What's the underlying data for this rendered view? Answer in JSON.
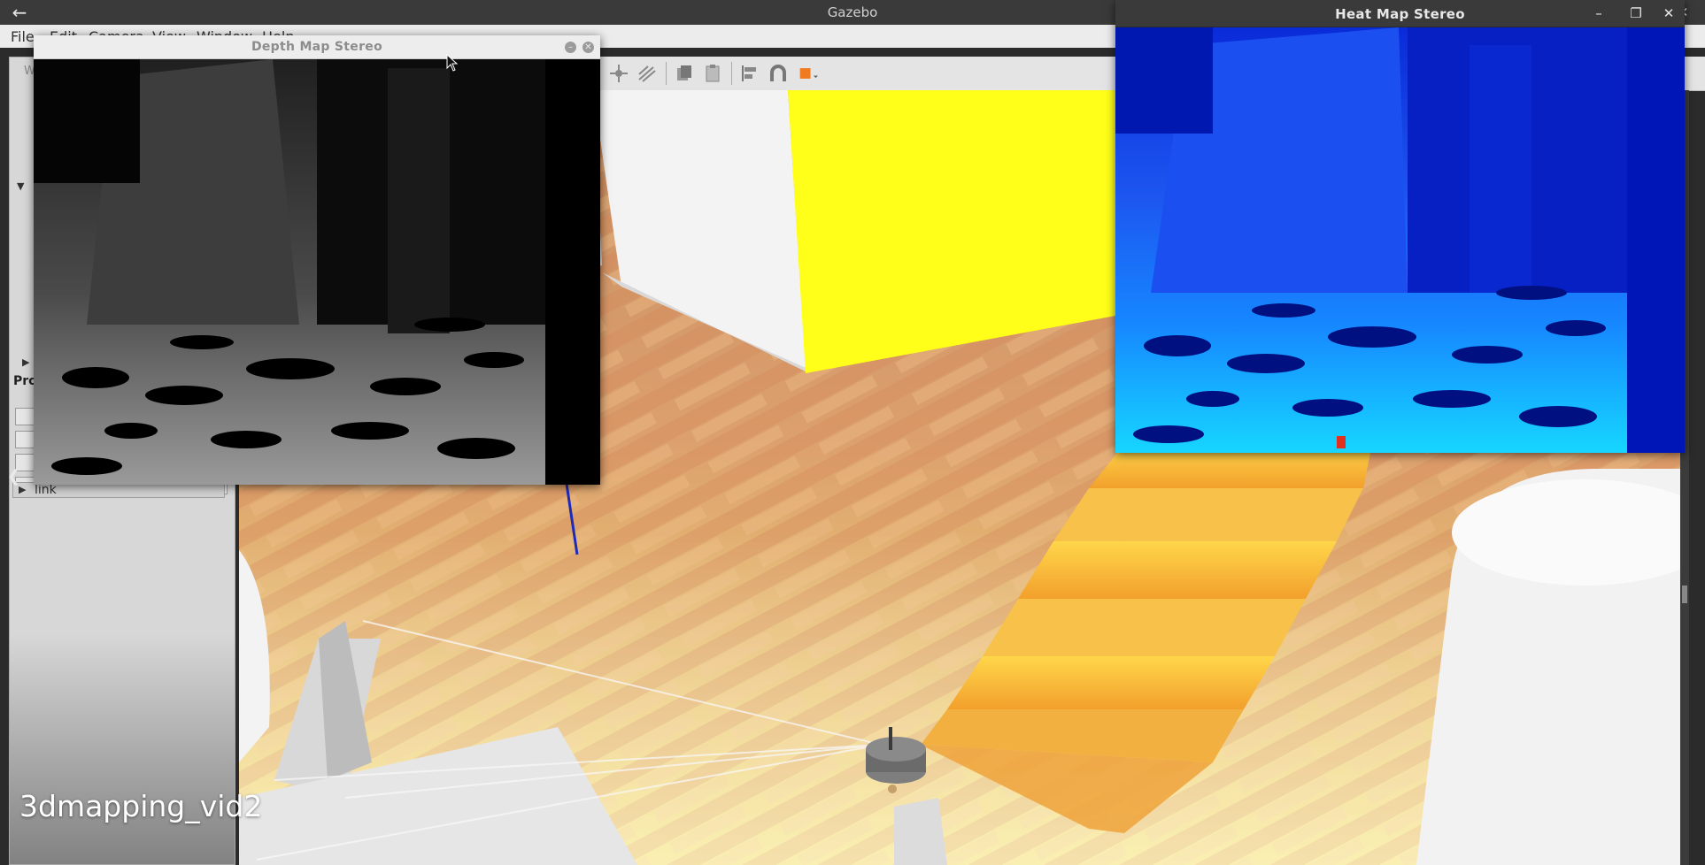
{
  "window": {
    "title": "Gazebo",
    "back_icon": "arrow-left-icon",
    "controls": [
      "minimize-icon",
      "restore-icon",
      "close-icon"
    ]
  },
  "menu": {
    "items": [
      "File",
      "Edit",
      "Camera",
      "View",
      "Window",
      "Help"
    ]
  },
  "left_panel": {
    "header_label": "W",
    "properties_label": "Pro",
    "tree_item_label": "link"
  },
  "toolbar": {
    "icons": [
      "translate-icon",
      "light-icon",
      "lines-icon",
      "copy-icon",
      "paste-icon",
      "align-icon",
      "magnet-icon",
      "shape-icon"
    ]
  },
  "depth_window": {
    "title": "Depth Map Stereo",
    "buttons": [
      "minimize-icon",
      "close-icon"
    ]
  },
  "heat_window": {
    "title": "Heat Map Stereo"
  },
  "watermark": "3dmapping_vid2",
  "colors": {
    "titlebar": "#3a3a3a",
    "floor": "#d69a68",
    "wall_yellow": "#ffff1a",
    "heat_deep": "#001aa8",
    "heat_mid": "#1e5cf0",
    "heat_cyan": "#19d8ff"
  }
}
